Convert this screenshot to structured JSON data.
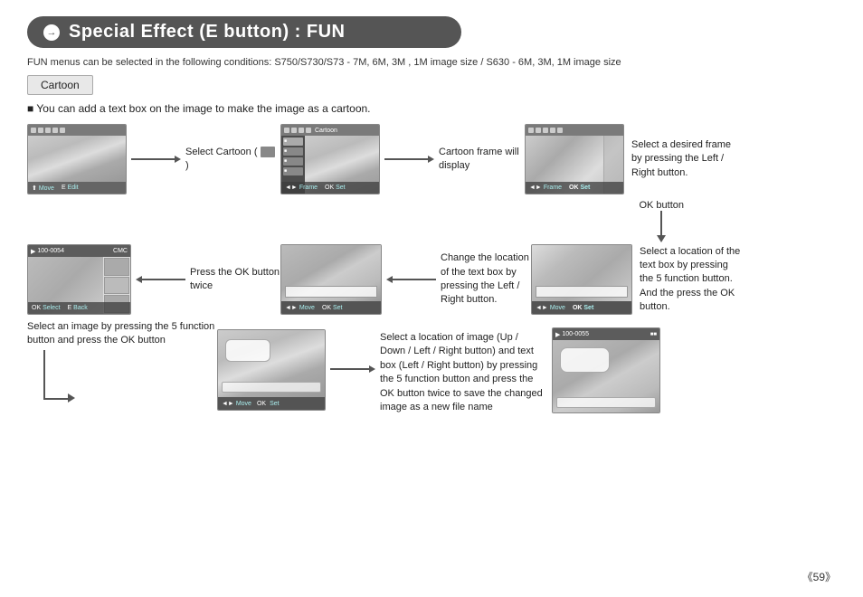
{
  "header": {
    "title": "Special Effect (E button) :  FUN",
    "bullet": "→"
  },
  "subtitle": "FUN menus can be selected in the following conditions: S750/S730/S73 - 7M, 6M, 3M , 1M image size / S630 - 6M, 3M, 1M image size",
  "tab": "Cartoon",
  "note": "■  You can add a text box on the image to make the image as a cartoon.",
  "row1": {
    "caption1": "Select Cartoon (      )",
    "caption2": "Cartoon frame will display",
    "caption3": "Select a desired frame by pressing the Left / Right button."
  },
  "row2": {
    "ok_label": "OK button",
    "caption1": "Press the OK button twice",
    "caption2": "Change the location of the text box by pressing the Left / Right button.",
    "caption3": "Select a location of the text box by pressing the 5 function button. And the press the OK button."
  },
  "row3": {
    "caption_above": "Select an image by pressing the 5 function\nbutton and press the OK button",
    "caption_right": "Select a location of image (Up / Down / Left / Right button) and text box (Left / Right button) by pressing the 5 function button and press the OK button twice to save the changed image as a new file name"
  },
  "footer": {
    "page": "《59》"
  }
}
